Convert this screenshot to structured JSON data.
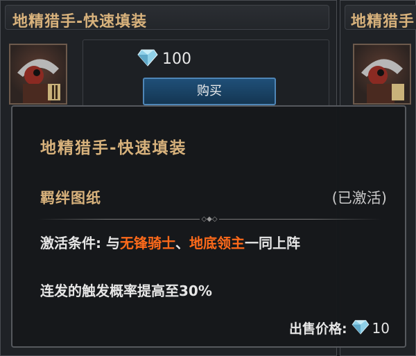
{
  "shop": {
    "card_title": "地精猎手-快速填装",
    "right_card_title": "地精猎手",
    "price": "100",
    "buy_label": "购买"
  },
  "tooltip": {
    "title": "地精猎手-快速填装",
    "subtitle": "羁绊图纸",
    "status": "(已激活)",
    "condition_prefix": "激活条件: 与",
    "hero1": "无锋骑士",
    "separator": "、",
    "hero2": "地底领主",
    "condition_suffix": "一同上阵",
    "effect": "连发的触发概率提高至30%",
    "sell_label": "出售价格:",
    "sell_value": "10"
  },
  "colors": {
    "gold_text": "#d8b27c",
    "highlight": "#ff6a1a",
    "button_blue": "#1f4f78"
  },
  "icons": [
    "diamond-gem-icon",
    "goblin-hunter-portrait"
  ]
}
